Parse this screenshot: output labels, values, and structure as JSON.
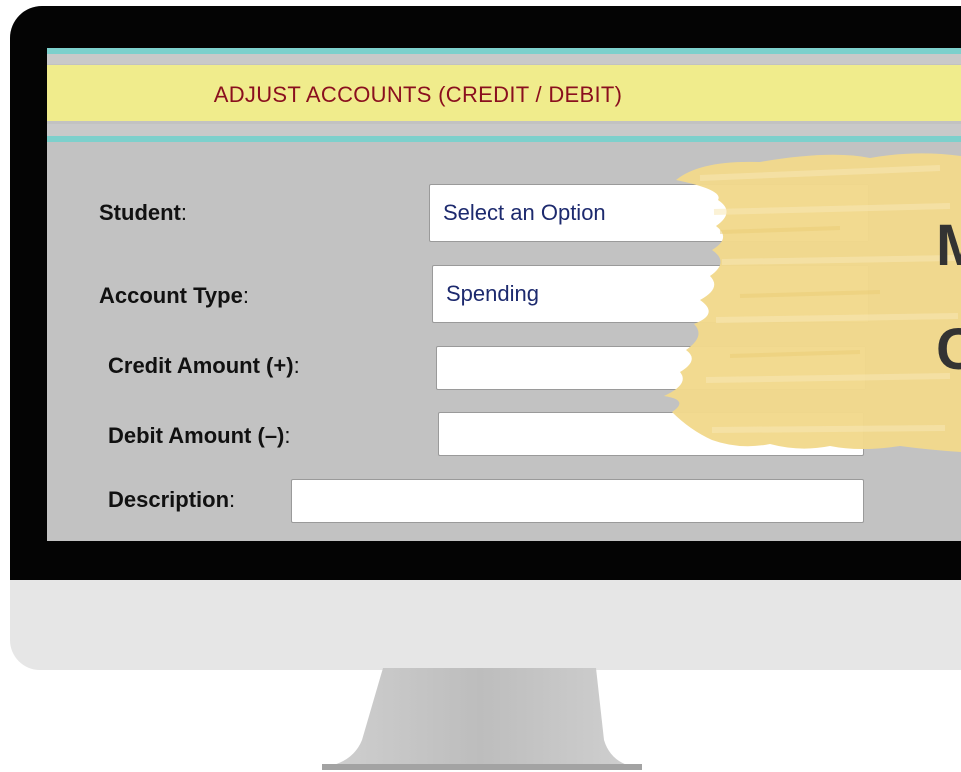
{
  "form": {
    "title": "ADJUST ACCOUNTS (CREDIT / DEBIT)",
    "student_label": "Student",
    "student_value": "Select an Option",
    "account_type_label": "Account Type",
    "account_type_value": "Spending",
    "credit_label": "Credit Amount (+)",
    "credit_value": "",
    "debit_label": "Debit Amount (–)",
    "debit_value": "",
    "description_label": "Description",
    "description_value": "",
    "colon": ":"
  },
  "overlay": {
    "line1": "M",
    "line2": "C"
  },
  "colors": {
    "header_band": "#f0ec8c",
    "header_text": "#8a0f1e",
    "teal_stripe": "#7dd0cc",
    "screen_background": "#c2c2c2",
    "brush_stroke": "#f2d98c",
    "bezel": "#040404"
  }
}
